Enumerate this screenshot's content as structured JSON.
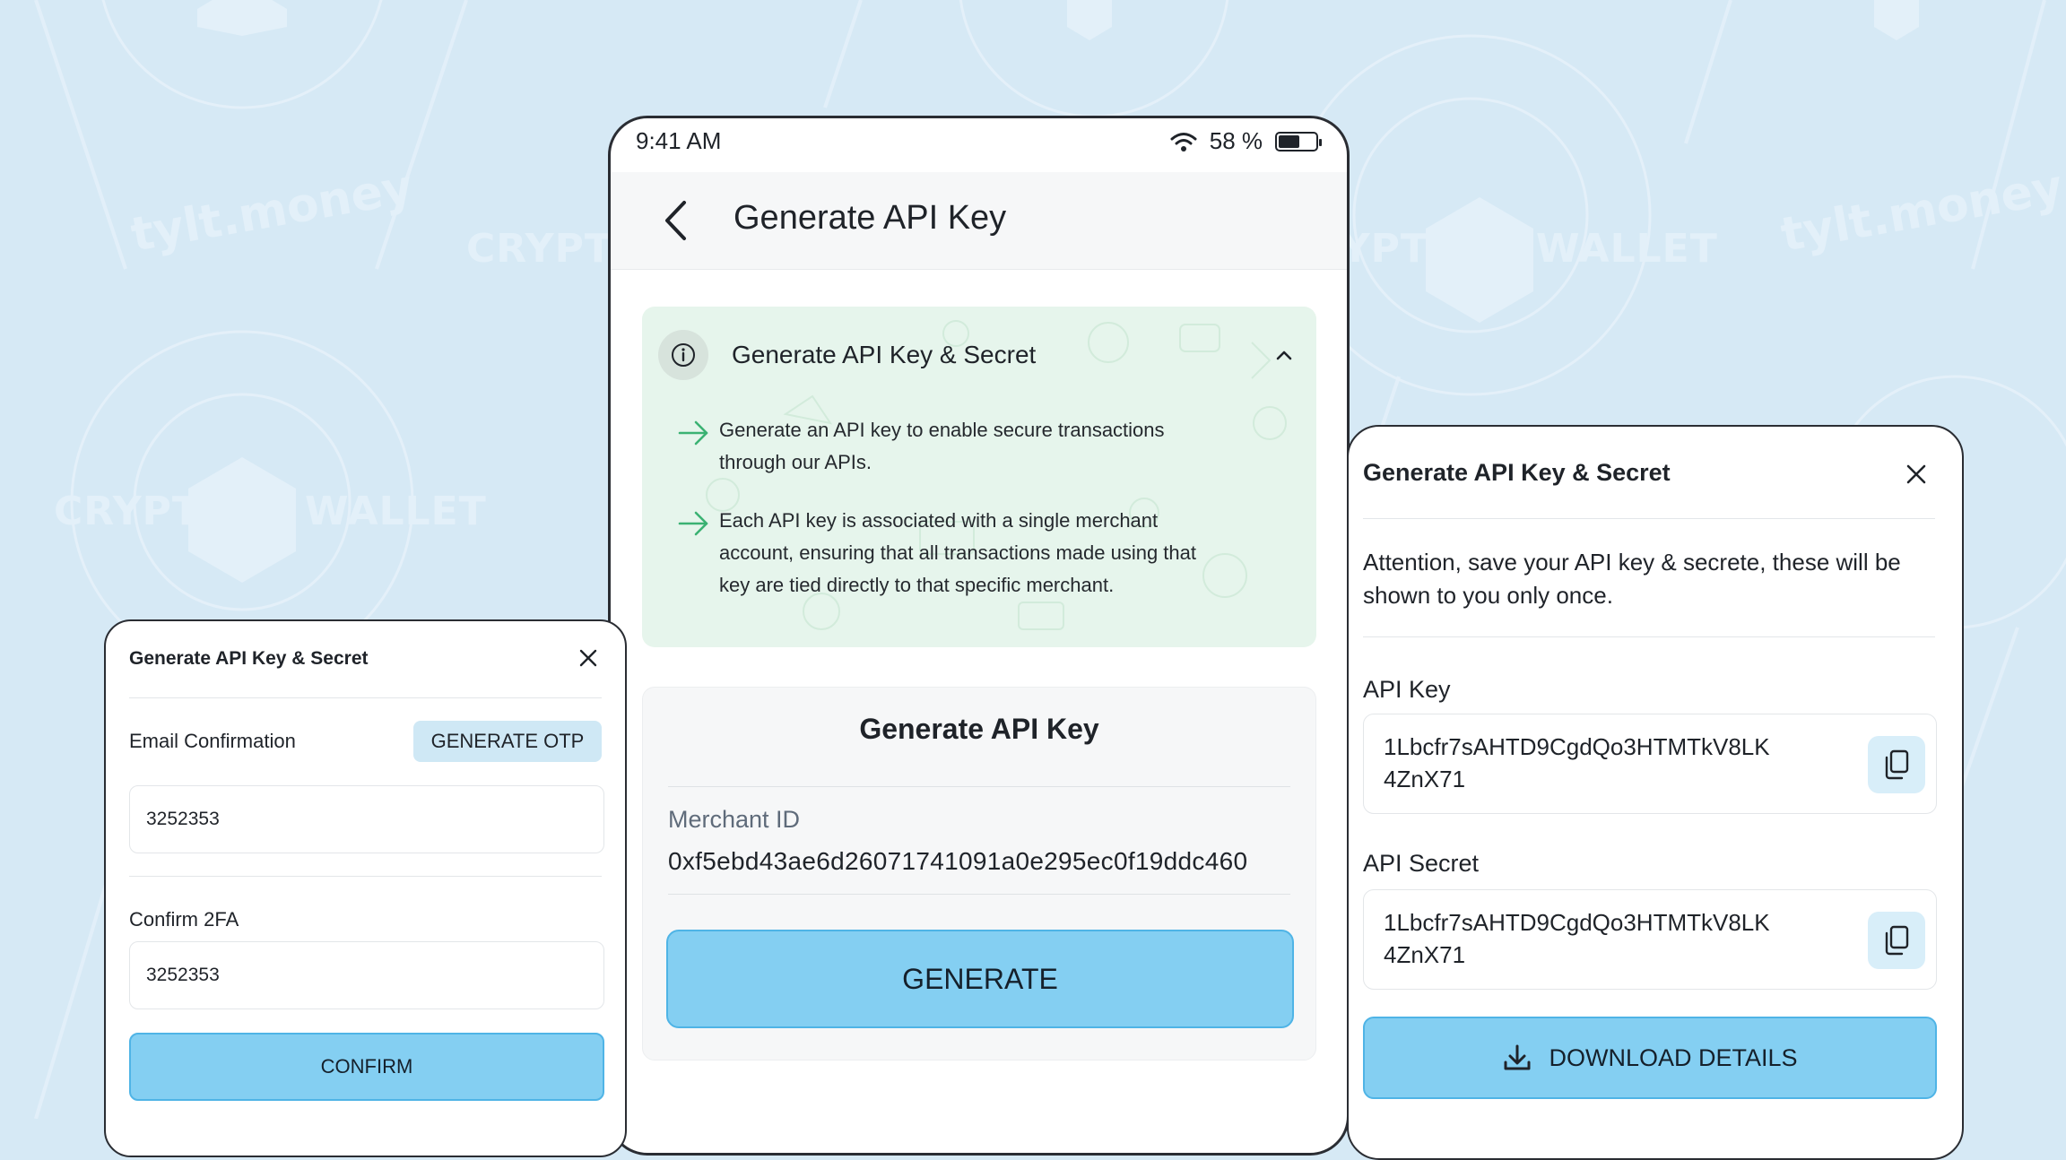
{
  "background": {
    "logo_text": "tylt.money",
    "word_left": "CRYPTO",
    "word_right": "WALLET",
    "colors": {
      "background": "#d6e9f5",
      "pattern": "#e3f0f9"
    }
  },
  "phone": {
    "status_bar": {
      "time": "9:41 AM",
      "battery_text": "58 %",
      "battery_level": 0.58
    },
    "header": {
      "title": "Generate API Key"
    },
    "info": {
      "title": "Generate API Key & Secret",
      "items": [
        {
          "line1": "Generate an API key to enable secure transactions",
          "line2": "through our APIs."
        },
        {
          "line1": "Each API key is associated with a single merchant",
          "line2": "account, ensuring that all transactions made using that",
          "line3": "key are tied directly to that specific merchant."
        }
      ]
    },
    "generate_card": {
      "title": "Generate API Key",
      "merchant_label": "Merchant ID",
      "merchant_id": "0xf5ebd43ae6d26071741091a0e295ec0f19ddc460",
      "button_label": "GENERATE"
    }
  },
  "left_modal": {
    "title": "Generate API Key & Secret",
    "email_label": "Email Confirmation",
    "otp_button": "GENERATE OTP",
    "email_code": "3252353",
    "twofa_label": "Confirm 2FA",
    "twofa_code": "3252353",
    "confirm_button": "CONFIRM"
  },
  "right_modal": {
    "title": "Generate API Key & Secret",
    "attention": "Attention, save your API key & secrete, these will be shown to you only once.",
    "api_key_label": "API Key",
    "api_key_line1": "1Lbcfr7sAHTD9CgdQo3HTMTkV8LK",
    "api_key_line2": "4ZnX71",
    "api_secret_label": "API Secret",
    "api_secret_line1": "1Lbcfr7sAHTD9CgdQo3HTMTkV8LK",
    "api_secret_line2": "4ZnX71",
    "download_button": "DOWNLOAD DETAILS"
  },
  "colors": {
    "accent_button": "#84cff2",
    "accent_border": "#4fb4e6",
    "info_card": "#e6f5ec",
    "arrow_green": "#3bb273"
  },
  "icons": [
    "back-icon",
    "wifi-icon",
    "battery-icon",
    "info-icon",
    "chevron-up-icon",
    "arrow-right-icon",
    "close-icon",
    "copy-icon",
    "download-icon"
  ]
}
